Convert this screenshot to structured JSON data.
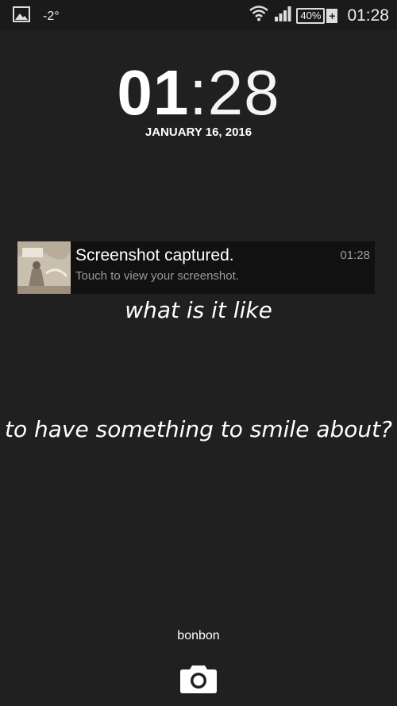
{
  "status_bar": {
    "temperature": "-2°",
    "battery": "40%",
    "battery_charging_symbol": "+",
    "time": "01:28",
    "icons": [
      "image-icon",
      "wifi-icon",
      "signal-icon",
      "battery-icon"
    ]
  },
  "lockscreen": {
    "clock_hours": "01",
    "clock_separator": ":",
    "clock_minutes": "28",
    "date": "JANUARY 16, 2016",
    "owner_info": "bonbon"
  },
  "notification": {
    "title": "Screenshot captured.",
    "subtitle": "Touch to view your screenshot.",
    "time": "01:28"
  },
  "wallpaper_text": {
    "line1": "what is it like",
    "line2": "to have something to smile about?"
  },
  "colors": {
    "background": "#202020",
    "notification_bg": "#111111",
    "secondary_text": "#9a9a9a"
  }
}
